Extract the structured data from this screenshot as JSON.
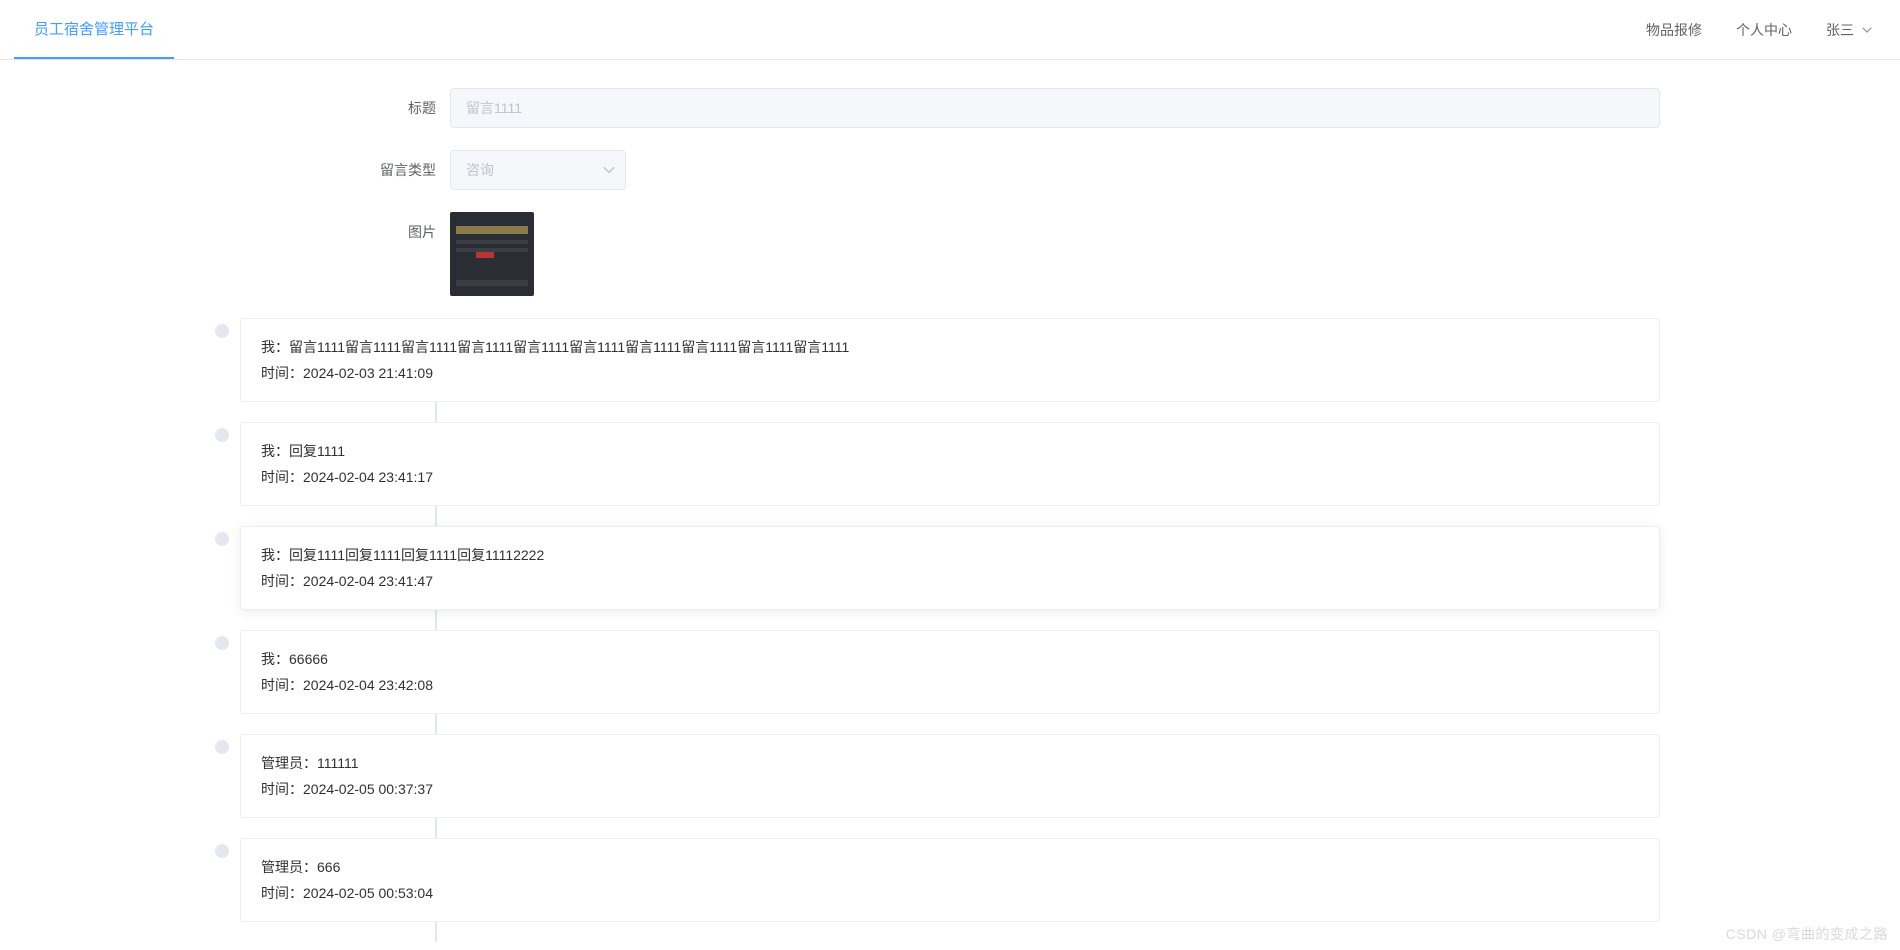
{
  "header": {
    "brand": "员工宿舍管理平台",
    "nav": {
      "repair": "物品报修",
      "profile": "个人中心"
    },
    "user": "张三"
  },
  "form": {
    "labels": {
      "title": "标题",
      "type": "留言类型",
      "image": "图片"
    },
    "title_value": "留言1111",
    "type_value": "咨询"
  },
  "prefixes": {
    "me": "我：",
    "admin": "管理员：",
    "time": "时间："
  },
  "messages": [
    {
      "who": "me",
      "text": "留言1111留言1111留言1111留言1111留言1111留言1111留言1111留言1111留言1111留言1111",
      "time": "2024-02-03 21:41:09"
    },
    {
      "who": "me",
      "text": "回复1111",
      "time": "2024-02-04 23:41:17"
    },
    {
      "who": "me",
      "text": "回复1111回复1111回复1111回复11112222",
      "time": "2024-02-04 23:41:47",
      "hovered": true
    },
    {
      "who": "me",
      "text": "66666",
      "time": "2024-02-04 23:42:08"
    },
    {
      "who": "admin",
      "text": "111111",
      "time": "2024-02-05 00:37:37"
    },
    {
      "who": "admin",
      "text": "666",
      "time": "2024-02-05 00:53:04"
    }
  ],
  "watermark": "CSDN @弯曲的变成之路"
}
